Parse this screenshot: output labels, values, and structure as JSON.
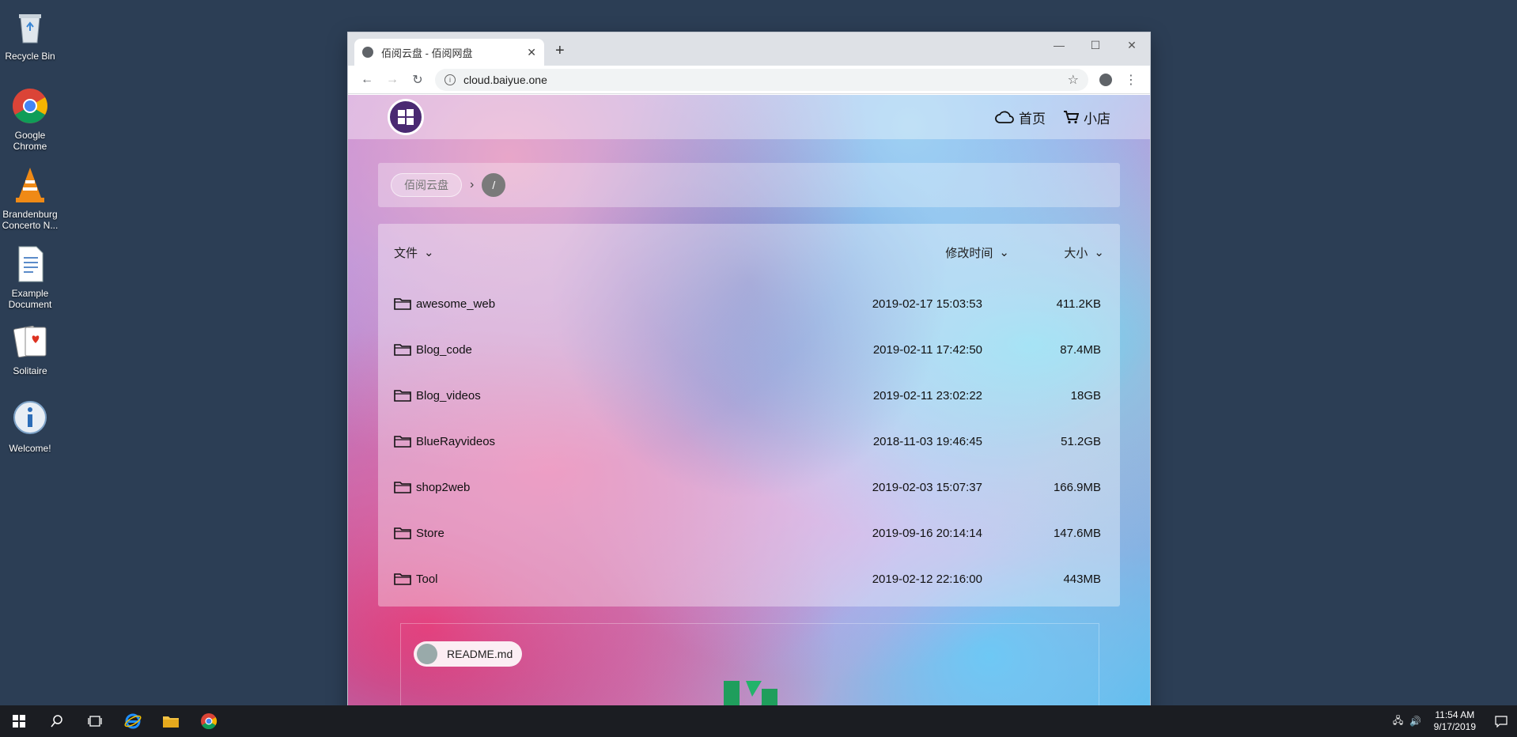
{
  "desktop": {
    "icons": [
      {
        "label": "Recycle Bin",
        "icon": "recycle-bin-icon"
      },
      {
        "label": "Google Chrome",
        "icon": "chrome-icon"
      },
      {
        "label": "Brandenburg Concerto N...",
        "icon": "vlc-icon"
      },
      {
        "label": "Example Document",
        "icon": "document-icon"
      },
      {
        "label": "Solitaire",
        "icon": "solitaire-icon"
      },
      {
        "label": "Welcome!",
        "icon": "info-icon"
      }
    ]
  },
  "browser": {
    "tab_title": "佰阅云盘 - 佰阅网盘",
    "url": "cloud.baiyue.one"
  },
  "site": {
    "nav": [
      {
        "label": "首页",
        "icon": "cloud-icon"
      },
      {
        "label": "小店",
        "icon": "cart-icon"
      }
    ],
    "breadcrumb": {
      "root": "佰阅云盘",
      "current": "/"
    },
    "columns": {
      "name": "文件",
      "modified": "修改时间",
      "size": "大小"
    },
    "files": [
      {
        "name": "awesome_web",
        "modified": "2019-02-17 15:03:53",
        "size": "411.2KB"
      },
      {
        "name": "Blog_code",
        "modified": "2019-02-11 17:42:50",
        "size": "87.4MB"
      },
      {
        "name": "Blog_videos",
        "modified": "2019-02-11 23:02:22",
        "size": "18GB"
      },
      {
        "name": "BlueRayvideos",
        "modified": "2018-11-03 19:46:45",
        "size": "51.2GB"
      },
      {
        "name": "shop2web",
        "modified": "2019-02-03 15:07:37",
        "size": "166.9MB"
      },
      {
        "name": "Store",
        "modified": "2019-09-16 20:14:14",
        "size": "147.6MB"
      },
      {
        "name": "Tool",
        "modified": "2019-02-12 22:16:00",
        "size": "443MB"
      }
    ],
    "readme_label": "README.md"
  },
  "taskbar": {
    "time": "11:54 AM",
    "date": "9/17/2019"
  },
  "colors": {
    "desktop_bg": "#2c3e55",
    "logo_bg": "#4a2a72",
    "taskbar_bg": "#1b1d22"
  }
}
